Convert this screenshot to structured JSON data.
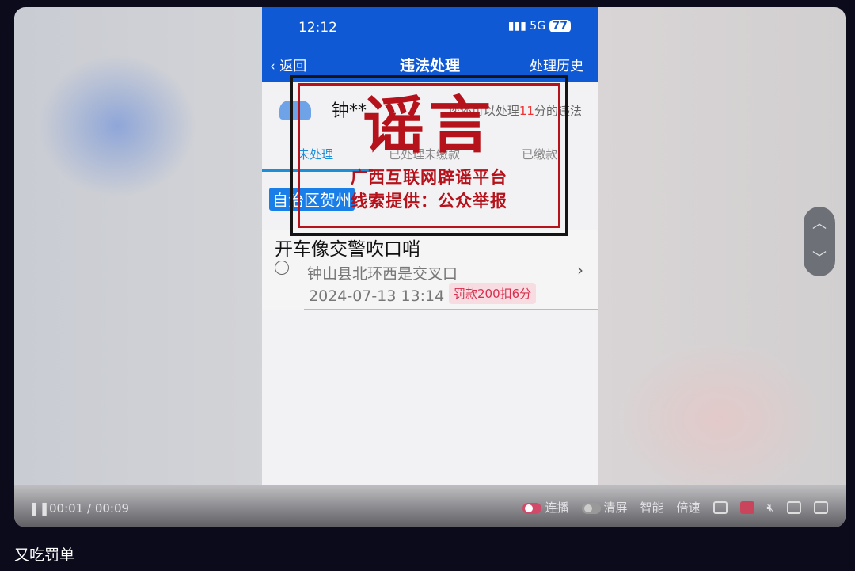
{
  "phone": {
    "status_time": "12:12",
    "network": "5G",
    "battery": "77",
    "nav": {
      "back": "返回",
      "title": "违法处理",
      "history": "处理历史"
    },
    "user": "钟**",
    "remain": {
      "prefix": "您还可以处理",
      "points": "11",
      "suffix": "分的违法"
    },
    "tabs": [
      "未处理",
      "已处理未缴款",
      "已缴款"
    ],
    "active_tab": "未处理",
    "region": "自治区贺州",
    "violation": {
      "title": "开车像交警吹口哨",
      "location": "钟山县北环西是交叉口",
      "datetime": "2024-07-13  13:14",
      "penalty": "罚款200扣6分"
    }
  },
  "stamp": {
    "headline": "谣言",
    "line1": "广西互联网辟谣平台",
    "line2": "线索提供：公众举报",
    "color": "#b5121b"
  },
  "player": {
    "current": "00:01",
    "total": "00:09",
    "progress": 0.11,
    "autoplay": "连播",
    "autoplay_on": true,
    "clear": "清屏",
    "clear_on": false,
    "smart": "智能",
    "speed": "倍速"
  },
  "caption": "又吃罚单"
}
